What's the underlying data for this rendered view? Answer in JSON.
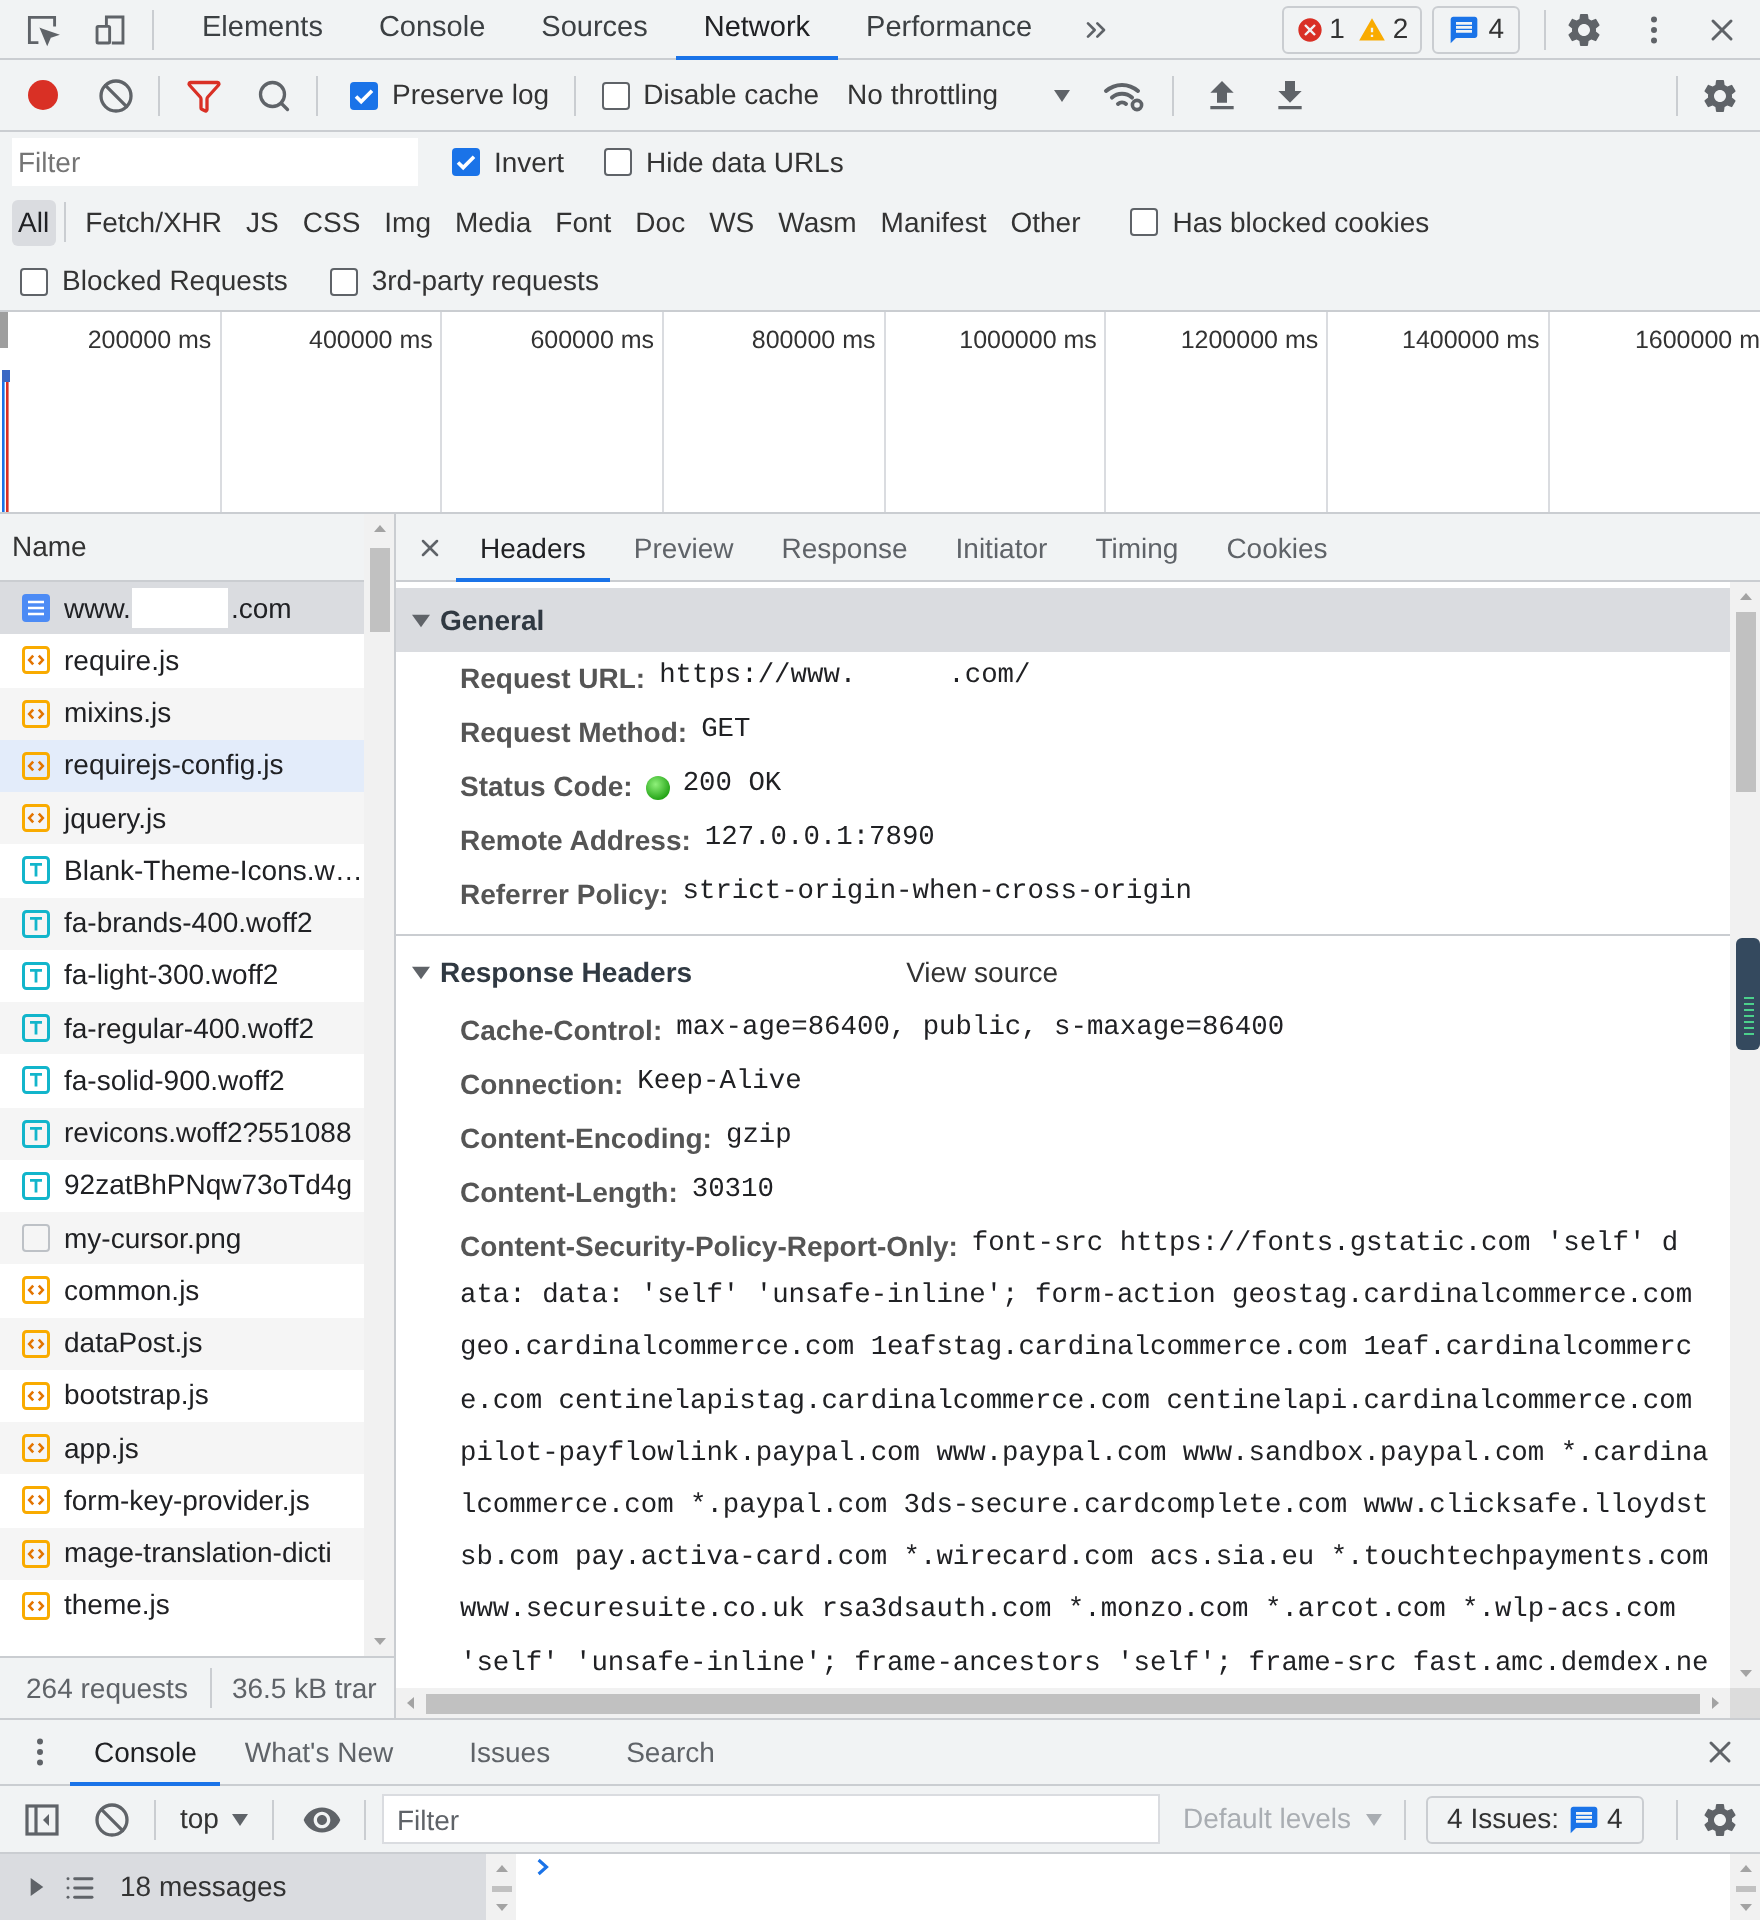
{
  "main_tabs": [
    {
      "label": "Elements",
      "selected": false
    },
    {
      "label": "Console",
      "selected": false
    },
    {
      "label": "Sources",
      "selected": false
    },
    {
      "label": "Network",
      "selected": true
    },
    {
      "label": "Performance",
      "selected": false
    }
  ],
  "issue_counters": {
    "errors": "1",
    "warnings": "2",
    "messages": "4"
  },
  "network_toolbar": {
    "recording": true,
    "options": [
      {
        "label": "Preserve log",
        "checked": true
      },
      {
        "label": "Disable cache",
        "checked": false
      }
    ],
    "throttling": "No throttling"
  },
  "filter_bar": {
    "placeholder": "Filter",
    "options": [
      {
        "label": "Invert",
        "checked": true
      },
      {
        "label": "Hide data URLs",
        "checked": false
      }
    ]
  },
  "type_filters": [
    {
      "label": "All",
      "selected": true
    },
    {
      "label": "Fetch/XHR",
      "selected": false
    },
    {
      "label": "JS",
      "selected": false
    },
    {
      "label": "CSS",
      "selected": false
    },
    {
      "label": "Img",
      "selected": false
    },
    {
      "label": "Media",
      "selected": false
    },
    {
      "label": "Font",
      "selected": false
    },
    {
      "label": "Doc",
      "selected": false
    },
    {
      "label": "WS",
      "selected": false
    },
    {
      "label": "Wasm",
      "selected": false
    },
    {
      "label": "Manifest",
      "selected": false
    },
    {
      "label": "Other",
      "selected": false
    }
  ],
  "type_options": [
    {
      "label": "Has blocked cookies",
      "checked": false
    }
  ],
  "extra_filters": [
    {
      "label": "Blocked Requests",
      "checked": false
    },
    {
      "label": "3rd-party requests",
      "checked": false
    }
  ],
  "timeline": {
    "ticks": [
      "200000 ms",
      "400000 ms",
      "600000 ms",
      "800000 ms",
      "1000000 ms",
      "1200000 ms",
      "1400000 ms",
      "1600000 m"
    ]
  },
  "request_list": {
    "column": "Name",
    "rows": [
      {
        "kind": "document",
        "name_parts": [
          "www.",
          ".com"
        ],
        "selected": true,
        "hovered": false
      },
      {
        "kind": "script",
        "name": "require.js",
        "selected": false,
        "hovered": false
      },
      {
        "kind": "script",
        "name": "mixins.js",
        "selected": false,
        "hovered": false
      },
      {
        "kind": "script",
        "name": "requirejs-config.js",
        "selected": false,
        "hovered": true
      },
      {
        "kind": "script",
        "name": "jquery.js",
        "selected": false,
        "hovered": false
      },
      {
        "kind": "font",
        "name": "Blank-Theme-Icons.w…",
        "selected": false,
        "hovered": false
      },
      {
        "kind": "font",
        "name": "fa-brands-400.woff2",
        "selected": false,
        "hovered": false
      },
      {
        "kind": "font",
        "name": "fa-light-300.woff2",
        "selected": false,
        "hovered": false
      },
      {
        "kind": "font",
        "name": "fa-regular-400.woff2",
        "selected": false,
        "hovered": false
      },
      {
        "kind": "font",
        "name": "fa-solid-900.woff2",
        "selected": false,
        "hovered": false
      },
      {
        "kind": "font",
        "name": "revicons.woff2?551088",
        "selected": false,
        "hovered": false
      },
      {
        "kind": "font",
        "name": "92zatBhPNqw73oTd4g",
        "selected": false,
        "hovered": false
      },
      {
        "kind": "image",
        "name": "my-cursor.png",
        "selected": false,
        "hovered": false
      },
      {
        "kind": "script",
        "name": "common.js",
        "selected": false,
        "hovered": false
      },
      {
        "kind": "script",
        "name": "dataPost.js",
        "selected": false,
        "hovered": false
      },
      {
        "kind": "script",
        "name": "bootstrap.js",
        "selected": false,
        "hovered": false
      },
      {
        "kind": "script",
        "name": "app.js",
        "selected": false,
        "hovered": false
      },
      {
        "kind": "script",
        "name": "form-key-provider.js",
        "selected": false,
        "hovered": false
      },
      {
        "kind": "script",
        "name": "mage-translation-dicti",
        "selected": false,
        "hovered": false
      },
      {
        "kind": "script",
        "name": "theme.js",
        "selected": false,
        "hovered": false
      }
    ]
  },
  "summary": [
    "264 requests",
    "36.5 kB trar"
  ],
  "detail_tabs": [
    {
      "label": "Headers",
      "selected": true
    },
    {
      "label": "Preview",
      "selected": false
    },
    {
      "label": "Response",
      "selected": false
    },
    {
      "label": "Initiator",
      "selected": false
    },
    {
      "label": "Timing",
      "selected": false
    },
    {
      "label": "Cookies",
      "selected": false
    }
  ],
  "sections": [
    {
      "title": "General",
      "selected": true,
      "expanded": true,
      "rows": [
        {
          "kind": "redacted",
          "label": "Request URL:",
          "value_parts": [
            "https://www.",
            ".com/"
          ]
        },
        {
          "kind": "plain",
          "label": "Request Method:",
          "value": "GET"
        },
        {
          "kind": "status",
          "label": "Status Code:",
          "value": "200 OK"
        },
        {
          "kind": "plain",
          "label": "Remote Address:",
          "value": "127.0.0.1:7890"
        },
        {
          "kind": "plain",
          "label": "Referrer Policy:",
          "value": "strict-origin-when-cross-origin"
        }
      ]
    },
    {
      "title": "Response Headers",
      "selected": false,
      "expanded": true,
      "action": "View source",
      "rows": [
        {
          "kind": "plain",
          "label": "Cache-Control:",
          "value": "max-age=86400, public, s-maxage=86400"
        },
        {
          "kind": "plain",
          "label": "Connection:",
          "value": "Keep-Alive"
        },
        {
          "kind": "plain",
          "label": "Content-Encoding:",
          "value": "gzip"
        },
        {
          "kind": "plain",
          "label": "Content-Length:",
          "value": "30310"
        },
        {
          "kind": "multiline",
          "label": "Content-Security-Policy-Report-Only:",
          "value_lines": [
            "font-src https://fonts.gstatic.com 'self' d",
            "ata: data: 'self' 'unsafe-inline'; form-action geostag.cardinalcommerce.com",
            "geo.cardinalcommerce.com 1eafstag.cardinalcommerce.com 1eaf.cardinalcommerc",
            "e.com centinelapistag.cardinalcommerce.com centinelapi.cardinalcommerce.com",
            "pilot-payflowlink.paypal.com www.paypal.com www.sandbox.paypal.com *.cardina",
            "lcommerce.com *.paypal.com 3ds-secure.cardcomplete.com www.clicksafe.lloydst",
            "sb.com pay.activa-card.com *.wirecard.com acs.sia.eu *.touchtechpayments.com",
            "www.securesuite.co.uk rsa3dsauth.com *.monzo.com *.arcot.com *.wlp-acs.com",
            "'self' 'unsafe-inline'; frame-ancestors 'self'; frame-src fast.amc.demdex.ne"
          ]
        }
      ]
    }
  ],
  "drawer": {
    "tabs": [
      {
        "label": "Console",
        "selected": true
      },
      {
        "label": "What's New",
        "selected": false
      },
      {
        "label": "Issues",
        "selected": false
      },
      {
        "label": "Search",
        "selected": false
      }
    ],
    "context": "top",
    "filter_placeholder": "Filter",
    "levels": {
      "label": "Default levels",
      "disabled": true
    },
    "issues": {
      "label": "4 Issues:",
      "count": "4"
    },
    "sidebar": [
      {
        "label": "18 messages",
        "selected": true,
        "expanded": false
      }
    ]
  }
}
